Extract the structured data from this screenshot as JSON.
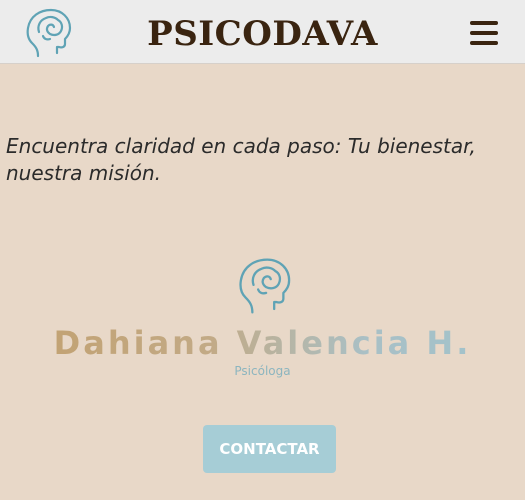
{
  "header": {
    "brand": "PSICODAVA",
    "logo_icon": "head-brain-icon",
    "menu_icon": "hamburger-menu-icon"
  },
  "main": {
    "tagline": "Encuentra claridad en cada paso: Tu bienestar, nuestra misión.",
    "logo_icon": "head-brain-icon",
    "name": "Dahiana Valencia H.",
    "subtitle": "Psicóloga",
    "cta_label": "CONTACTAR"
  },
  "colors": {
    "background": "#e8d8c8",
    "header_background": "#ececec",
    "brand_text": "#3a2410",
    "icon_stroke": "#5fa3b5",
    "name_gold": "#c2a06e",
    "name_teal": "#9fc3cc",
    "button": "#a6cdd6",
    "button_text": "#ffffff"
  }
}
